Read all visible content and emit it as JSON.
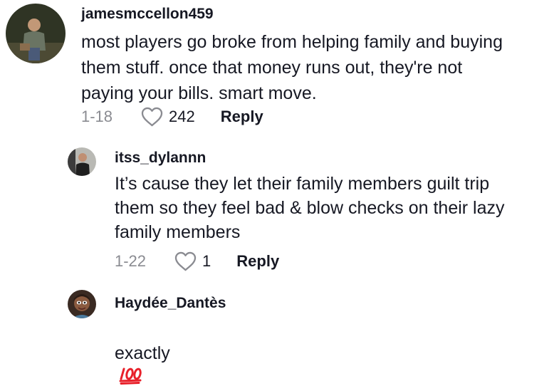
{
  "comments": [
    {
      "username": "jamesmccellon459",
      "text": "most players go broke from helping family and buying\nthem stuff. once that money runs out, they're not\npaying your bills. smart move.",
      "date": "1-18",
      "likes": "242",
      "reply_label": "Reply"
    },
    {
      "username": "itss_dylannn",
      "text": "It’s cause they let their family members guilt trip\nthem so they feel bad & blow checks on their lazy\nfamily members",
      "date": "1-22",
      "likes": "1",
      "reply_label": "Reply"
    },
    {
      "username": "Haydée_Dantès",
      "text": "exactly",
      "emoji": "100-emoji"
    }
  ],
  "icons": {
    "like": "heart-outline-icon"
  },
  "colors": {
    "text": "#161823",
    "muted": "#8a8b91",
    "emoji_red": "#e8202a"
  }
}
